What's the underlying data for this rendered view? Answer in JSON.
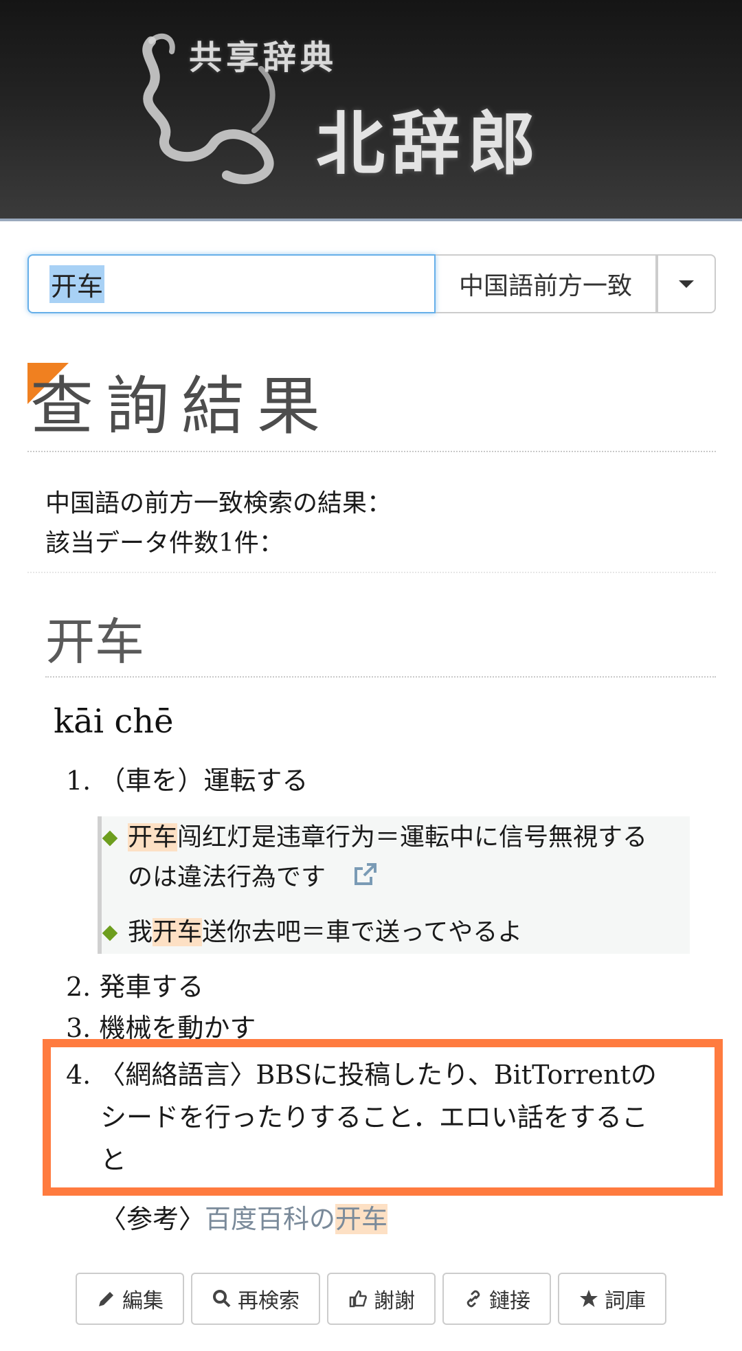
{
  "header": {
    "logo_small": "共享辞典",
    "logo_big": "北辞郎"
  },
  "search": {
    "query": "开车",
    "mode": "中国語前方一致"
  },
  "results": {
    "heading": "查詢結果",
    "summary_line1": "中国語の前方一致検索の結果：",
    "summary_line2": "該当データ件数1件："
  },
  "entry": {
    "word": "开车",
    "pinyin": "kāi chē",
    "definitions": [
      {
        "num": "1.",
        "text": "（車を）運転する"
      },
      {
        "num": "2.",
        "text": "発車する"
      },
      {
        "num": "3.",
        "text": "機械を動かす"
      },
      {
        "num": "4.",
        "text_line1": "〈網絡語言〉BBSに投稿したり、BitTorrentの",
        "text_line2": "シードを行ったりすること．エロい話をするこ",
        "text_line3": "と"
      }
    ],
    "examples": [
      {
        "hl": "开车",
        "rest_line1": "闯红灯是违章行为＝運転中に信号無視する",
        "line2": "のは違法行為です"
      },
      {
        "pre": "我",
        "hl": "开车",
        "rest": "送你去吧＝車で送ってやるよ"
      }
    ],
    "reference": {
      "label": "〈参考〉",
      "link_text": "百度百科の",
      "link_hl": "开车"
    }
  },
  "buttons": {
    "edit": "編集",
    "research": "再検索",
    "thanks": "謝謝",
    "link": "鏈接",
    "wordbook": "詞庫"
  },
  "colors": {
    "accent_orange": "#ff7b3f",
    "highlight": "#fde0c4",
    "focus_blue": "#66afe9",
    "bullet_green": "#6d9e1e"
  }
}
